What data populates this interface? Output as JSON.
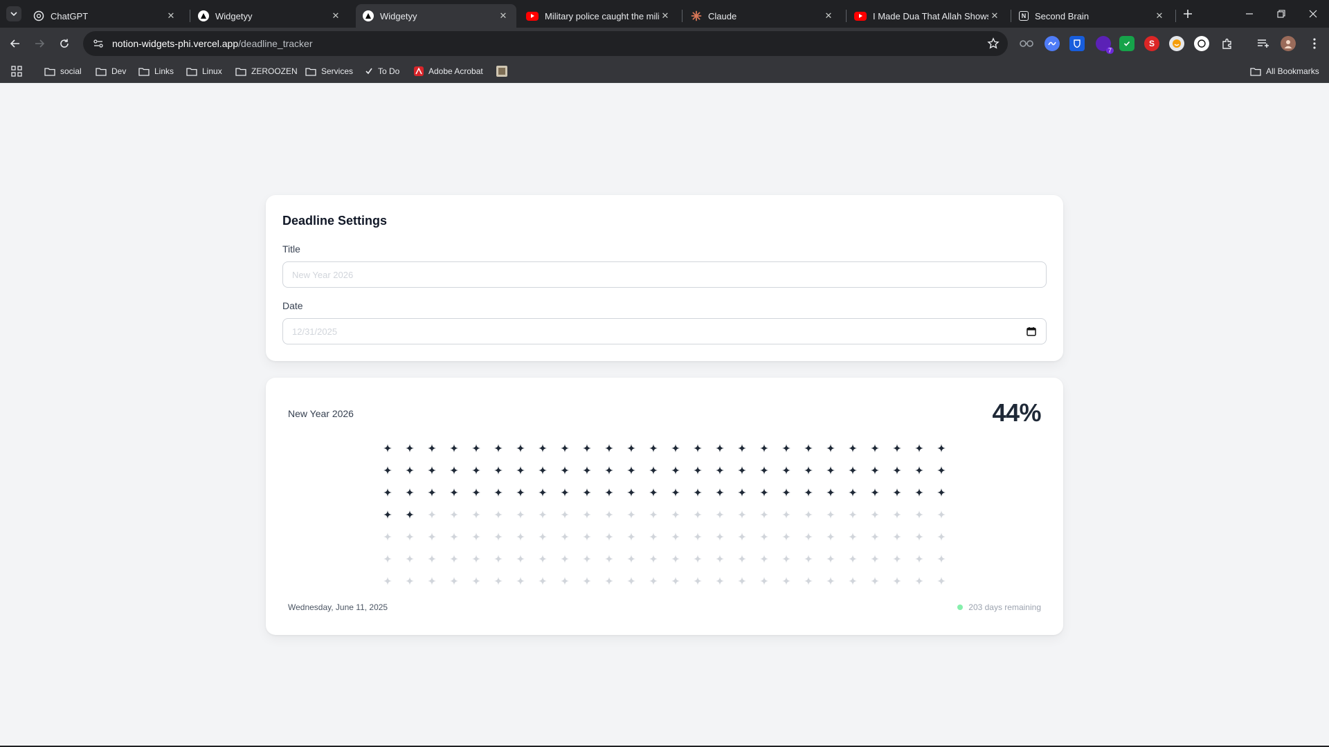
{
  "browser": {
    "tabs": [
      {
        "title": "ChatGPT",
        "icon": "chatgpt-icon",
        "active": false
      },
      {
        "title": "Widgetyy",
        "icon": "triangle-logo-icon",
        "active": false
      },
      {
        "title": "Widgetyy",
        "icon": "triangle-logo-icon",
        "active": true
      },
      {
        "title": "Military police caught the milita",
        "icon": "youtube-icon",
        "active": false
      },
      {
        "title": "Claude",
        "icon": "claude-icon",
        "active": false
      },
      {
        "title": "I Made Dua That Allah Shows T",
        "icon": "youtube-icon",
        "active": false
      },
      {
        "title": "Second Brain",
        "icon": "notion-icon",
        "active": false
      }
    ],
    "url_host": "notion-widgets-phi.vercel.app",
    "url_path": "/deadline_tracker",
    "bookmarks": [
      {
        "label": "social",
        "icon": "folder-icon"
      },
      {
        "label": "Dev",
        "icon": "folder-icon"
      },
      {
        "label": "Links",
        "icon": "folder-icon"
      },
      {
        "label": "Linux",
        "icon": "folder-icon"
      },
      {
        "label": "ZEROOZEN",
        "icon": "folder-icon"
      },
      {
        "label": "Services",
        "icon": "folder-icon"
      },
      {
        "label": "To Do",
        "icon": "todo-icon"
      },
      {
        "label": "Adobe Acrobat",
        "icon": "acrobat-icon"
      }
    ],
    "all_bookmarks": "All Bookmarks",
    "extension_badge": "7",
    "colors": {
      "youtube": "#ff0000",
      "claude": "#d97757",
      "chrome_dark": "#202124"
    }
  },
  "settings": {
    "heading": "Deadline Settings",
    "title_label": "Title",
    "title_placeholder": "New Year 2026",
    "date_label": "Date",
    "date_placeholder": "12/31/2025"
  },
  "tracker": {
    "title": "New Year 2026",
    "percent": "44%",
    "progress_fraction": 0.44,
    "total_marks": 182,
    "filled_marks": 80,
    "current_date": "Wednesday, June 11, 2025",
    "remaining": "203 days remaining",
    "colors": {
      "filled": "#1f2937",
      "empty": "#d1d5db",
      "status": "#86efac"
    }
  }
}
